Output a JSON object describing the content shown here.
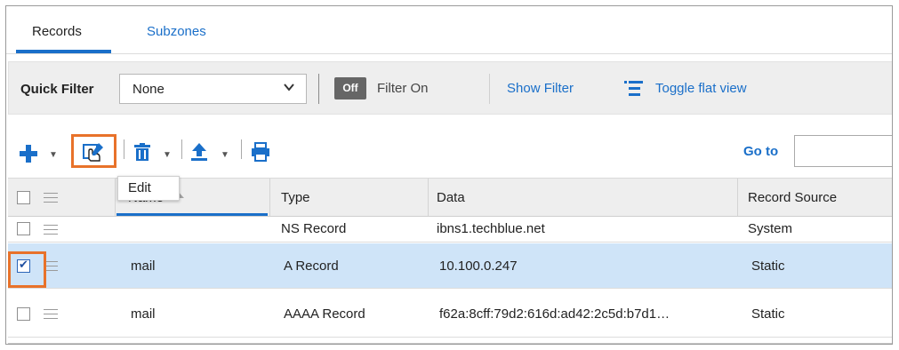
{
  "tabs": [
    {
      "label": "Records"
    },
    {
      "label": "Subzones"
    }
  ],
  "filter": {
    "quick_filter_label": "Quick Filter",
    "quick_filter_value": "None",
    "toggle_badge": "Off",
    "filter_on_label": "Filter On",
    "show_filter": "Show Filter",
    "toggle_flat_view": "Toggle flat view"
  },
  "toolbar": {
    "tooltip": "Edit",
    "goto_label": "Go to",
    "goto_value": ""
  },
  "grid": {
    "columns": [
      "Name",
      "Type",
      "Data",
      "Record Source"
    ],
    "rows": [
      {
        "name": "",
        "type": "NS Record",
        "data": "ibns1.techblue.net",
        "source": "System",
        "checked": false
      },
      {
        "name": "mail",
        "type": "A Record",
        "data": "10.100.0.247",
        "source": "Static",
        "checked": true
      },
      {
        "name": "mail",
        "type": "AAAA Record",
        "data": "f62a:8cff:79d2:616d:ad42:2c5d:b7d1…",
        "source": "Static",
        "checked": false
      }
    ]
  },
  "colors": {
    "accent": "#1a6fc9",
    "highlight": "#e8722a",
    "selected_row": "#cfe4f8"
  },
  "icons": [
    "plus-icon",
    "edit-icon",
    "trash-icon",
    "upload-icon",
    "print-icon",
    "list-view-icon",
    "chevron-down-icon",
    "drag-handle-icon"
  ]
}
